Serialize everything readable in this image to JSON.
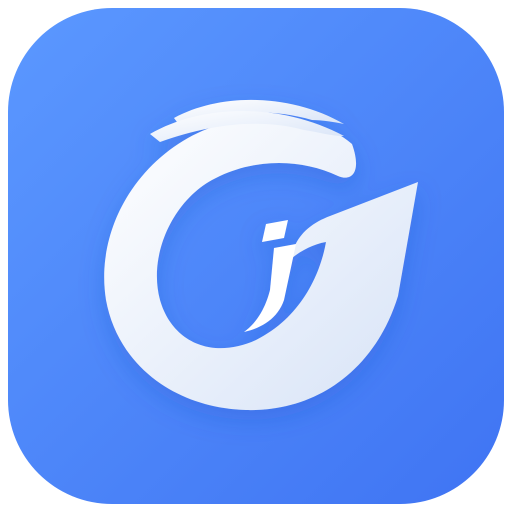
{
  "icon": {
    "name": "app-logo-icon",
    "colors": {
      "background_top": "#5B98FF",
      "background_bottom": "#3F74F3",
      "mark": "#FFFFFF",
      "mark_shadow": "#D7E3F7"
    }
  }
}
